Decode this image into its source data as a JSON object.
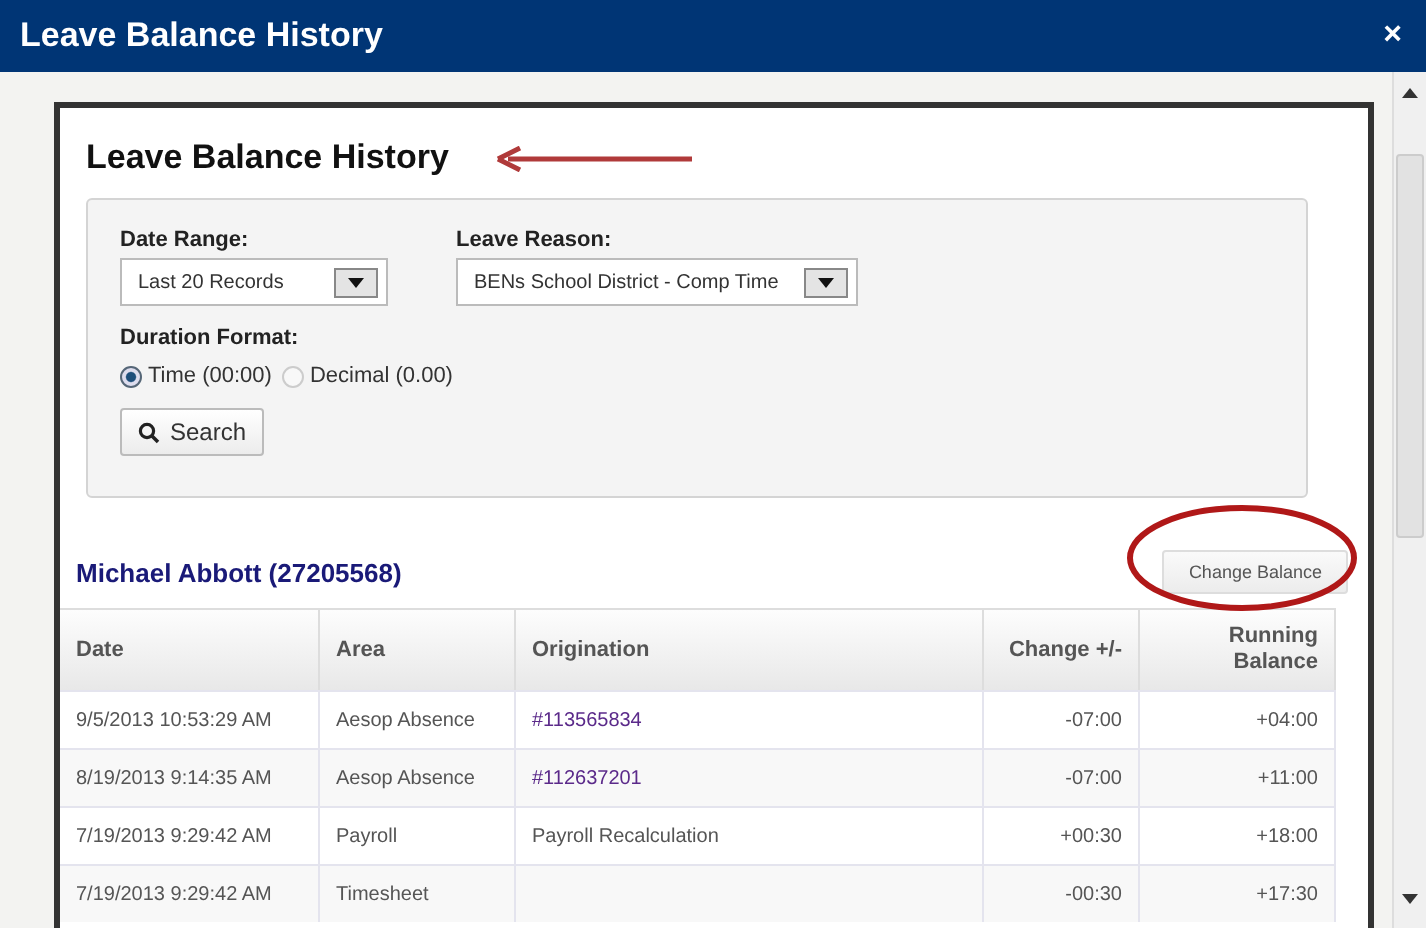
{
  "window": {
    "title": "Leave Balance History",
    "close": "×"
  },
  "panel": {
    "title": "Leave Balance History"
  },
  "filters": {
    "date_range": {
      "label": "Date Range:",
      "value": "Last 20 Records"
    },
    "leave_reason": {
      "label": "Leave Reason:",
      "value": "BENs School District - Comp Time"
    },
    "duration_format": {
      "label": "Duration Format:",
      "options": [
        {
          "label": "Time (00:00)",
          "selected": true
        },
        {
          "label": "Decimal (0.00)",
          "selected": false
        }
      ]
    },
    "search_button": "Search"
  },
  "employee": {
    "name": "Michael Abbott (27205568)",
    "button": "Change Balance"
  },
  "table": {
    "columns": [
      "Date",
      "Area",
      "Origination",
      "Change +/-",
      "Running Balance"
    ],
    "rows": [
      {
        "date": "9/5/2013 10:53:29 AM",
        "area": "Aesop Absence",
        "origination": {
          "text": "#113565834",
          "kind": "link"
        },
        "change": "-07:00",
        "balance": "+04:00"
      },
      {
        "date": "8/19/2013 9:14:35 AM",
        "area": "Aesop Absence",
        "origination": {
          "text": "#112637201",
          "kind": "link"
        },
        "change": "-07:00",
        "balance": "+11:00"
      },
      {
        "date": "7/19/2013 9:29:42 AM",
        "area": "Payroll",
        "origination": {
          "text": "Payroll Recalculation",
          "kind": "text"
        },
        "change": "+00:30",
        "balance": "+18:00"
      },
      {
        "date": "7/19/2013 9:29:42 AM",
        "area": "Timesheet",
        "change": "-00:30",
        "balance": "+17:30"
      }
    ]
  }
}
